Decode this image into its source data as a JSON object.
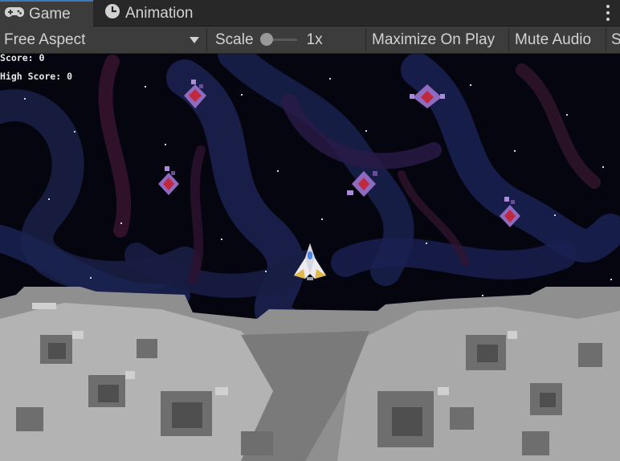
{
  "tabs": [
    {
      "label": "Game",
      "icon": "gamepad-icon",
      "active": true
    },
    {
      "label": "Animation",
      "icon": "clock-icon",
      "active": false
    }
  ],
  "toolbar": {
    "aspect": "Free Aspect",
    "scale_label": "Scale",
    "scale_value": "1x",
    "maximize": "Maximize On Play",
    "mute": "Mute Audio",
    "stats": "S"
  },
  "hud": {
    "score": "Score: 0",
    "high_score": "High Score: 0"
  },
  "colors": {
    "tab_accent": "#3a79bb",
    "enemy_body": "#8e6bbf",
    "enemy_core": "#c1283b",
    "player_ship": "#ececf0",
    "space_bg": "#050510",
    "moon_light": "#b9b9b9"
  }
}
